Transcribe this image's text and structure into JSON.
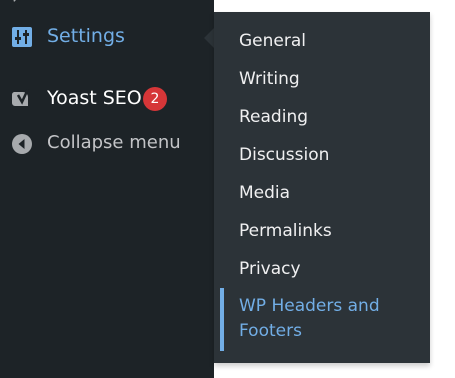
{
  "sidebar": {
    "items": [
      {
        "label": "Settings",
        "icon": "settings-sliders-icon"
      },
      {
        "label": "Yoast SEO",
        "icon": "yoast-icon",
        "badge": "2"
      },
      {
        "label": "Collapse menu",
        "icon": "collapse-arrow-icon"
      }
    ]
  },
  "submenu": {
    "items": [
      {
        "label": "General"
      },
      {
        "label": "Writing"
      },
      {
        "label": "Reading"
      },
      {
        "label": "Discussion"
      },
      {
        "label": "Media"
      },
      {
        "label": "Permalinks"
      },
      {
        "label": "Privacy"
      },
      {
        "label": "WP Headers and Footers",
        "current": true
      }
    ]
  },
  "colors": {
    "sidebar_bg": "#1d2327",
    "submenu_bg": "#2c3338",
    "accent": "#72aee6",
    "badge": "#d63638"
  }
}
